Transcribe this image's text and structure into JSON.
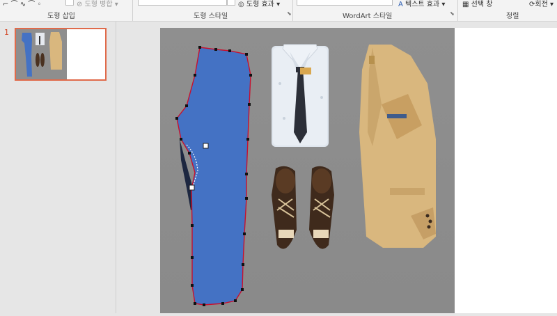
{
  "ribbon": {
    "groups": [
      {
        "label": "도형 삽입"
      },
      {
        "label": "도형 스타일"
      },
      {
        "label": "WordArt 스타일"
      },
      {
        "label": "정렬"
      }
    ],
    "items": {
      "merge_shapes": "도형 병합",
      "shape_effects": "도형 효과",
      "text_effects": "텍스트 효과",
      "selection_pane": "선택 창",
      "rotate": "회전"
    }
  },
  "slides": [
    {
      "number": "1",
      "selected": true
    }
  ],
  "colors": {
    "shape_fill": "#4472c4",
    "shape_outline": "#c8102e",
    "selection_border": "#e06a4a",
    "canvas_bg": "#8e8e8e"
  }
}
